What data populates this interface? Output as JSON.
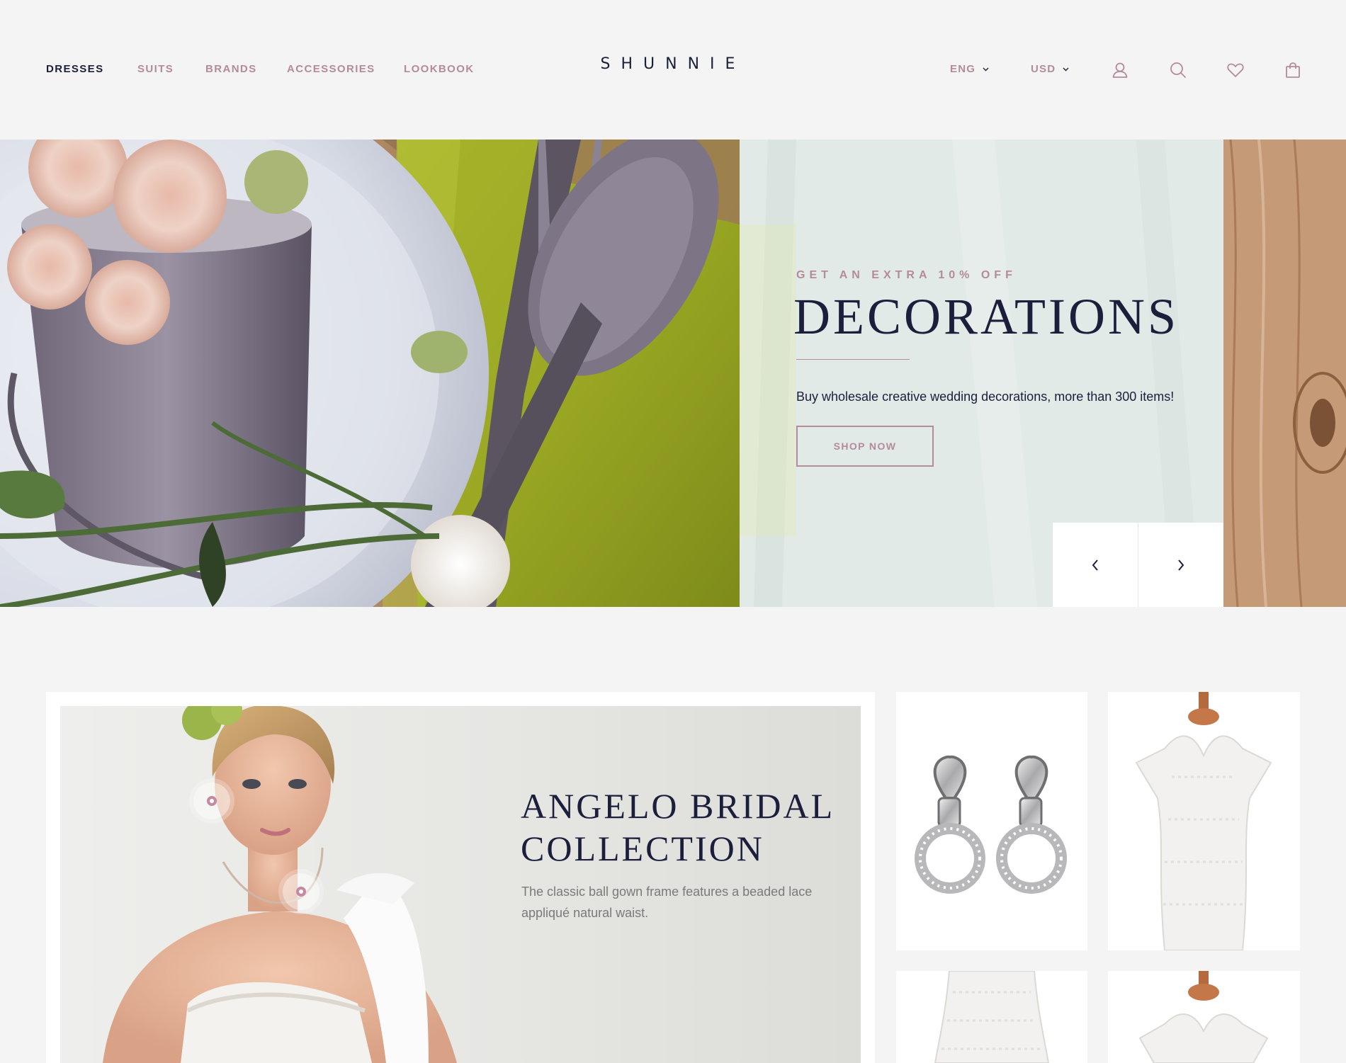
{
  "nav": {
    "items": [
      {
        "label": "DRESSES",
        "active": true
      },
      {
        "label": "SUITS",
        "active": false
      },
      {
        "label": "BRANDS",
        "active": false
      },
      {
        "label": "ACCESSORIES",
        "active": false
      },
      {
        "label": "LOOKBOOK",
        "active": false
      }
    ]
  },
  "brand": {
    "logo": "SHUNNIE"
  },
  "header": {
    "language": "ENG",
    "currency": "USD",
    "icons": [
      "account-icon",
      "search-icon",
      "heart-icon",
      "bag-icon"
    ]
  },
  "hero": {
    "eyebrow": "GET AN EXTRA 10% OFF",
    "title": "DECORATIONS",
    "description": "Buy wholesale creative wedding decorations, more than 300 items!",
    "cta": "SHOP NOW",
    "prev_icon": "chevron-left-icon",
    "next_icon": "chevron-right-icon"
  },
  "collection": {
    "title_line1": "ANGELO BRIDAL",
    "title_line2": "COLLECTION",
    "description": "The classic ball gown frame features a beaded lace appliqué natural waist."
  },
  "colors": {
    "accent": "#b48a9c",
    "navy": "#1b1f3b",
    "background": "#f4f4f4"
  }
}
